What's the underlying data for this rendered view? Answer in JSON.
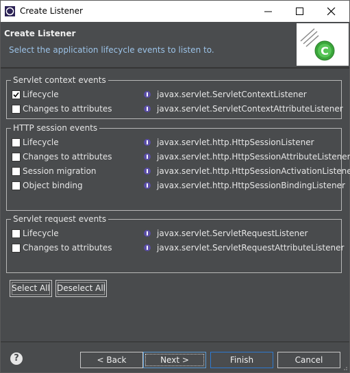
{
  "window": {
    "title": "Create Listener"
  },
  "header": {
    "title": "Create Listener",
    "description": "Select the application lifecycle events to listen to."
  },
  "groups": [
    {
      "title": "Servlet context events",
      "rows": [
        {
          "label": "Lifecycle",
          "checked": true,
          "class_name": "javax.servlet.ServletContextListener"
        },
        {
          "label": "Changes to attributes",
          "checked": false,
          "class_name": "javax.servlet.ServletContextAttributeListener"
        }
      ]
    },
    {
      "title": "HTTP session events",
      "rows": [
        {
          "label": "Lifecycle",
          "checked": false,
          "class_name": "javax.servlet.http.HttpSessionListener"
        },
        {
          "label": "Changes to attributes",
          "checked": false,
          "class_name": "javax.servlet.http.HttpSessionAttributeListener"
        },
        {
          "label": "Session migration",
          "checked": false,
          "class_name": "javax.servlet.http.HttpSessionActivationListener"
        },
        {
          "label": "Object binding",
          "checked": false,
          "class_name": "javax.servlet.http.HttpSessionBindingListener"
        }
      ]
    },
    {
      "title": "Servlet request events",
      "rows": [
        {
          "label": "Lifecycle",
          "checked": false,
          "class_name": "javax.servlet.ServletRequestListener"
        },
        {
          "label": "Changes to attributes",
          "checked": false,
          "class_name": "javax.servlet.ServletRequestAttributeListener"
        }
      ]
    }
  ],
  "selection_buttons": {
    "select_all": "Select All",
    "deselect_all": "Deselect All"
  },
  "footer": {
    "help": "?",
    "back": "< Back",
    "next": "Next >",
    "finish": "Finish",
    "cancel": "Cancel"
  },
  "colors": {
    "background": "#494b4d",
    "description": "#9cc3e8",
    "interface_icon": "#5b4ea8"
  }
}
